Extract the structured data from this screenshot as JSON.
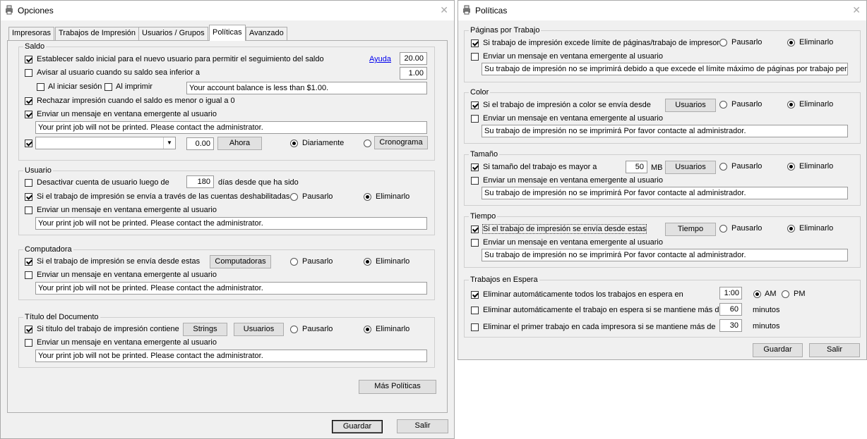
{
  "opciones": {
    "title": "Opciones",
    "close": "✕",
    "tabs": [
      "Impresoras",
      "Trabajos de Impresión",
      "Usuarios / Grupos",
      "Políticas",
      "Avanzado"
    ],
    "saldo": {
      "title": "Saldo",
      "initial_balance_label": "Establecer saldo inicial para el nuevo usuario para permitir el seguimiento del saldo",
      "help_link": "Ayuda",
      "initial_balance_value": "20.00",
      "notify_low_label": "Avisar al usuario cuando su saldo sea inferior a",
      "notify_low_value": "1.00",
      "on_login_label": "Al iniciar sesión",
      "on_print_label": "Al imprimir",
      "low_balance_message": "Your account balance is less than $1.00.",
      "reject_label": "Rechazar impresión cuando el saldo es menor o igual a 0",
      "popup_label": "Enviar un mensaje en ventana emergente al usuario",
      "popup_message": "Your print job will not be printed. Please contact the administrator.",
      "schedule_combo": "",
      "schedule_amount": "0.00",
      "now_button": "Ahora",
      "daily_label": "Diariamente",
      "schedule_button": "Cronograma"
    },
    "usuario": {
      "title": "Usuario",
      "deactivate_label": "Desactivar cuenta de usuario luego de",
      "deactivate_days": "180",
      "days_label": "días desde que ha sido",
      "disabled_accounts_label": "Si el trabajo de impresión se envía a través de las cuentas deshabilitadas",
      "pause_label": "Pausarlo",
      "delete_label": "Eliminarlo",
      "popup_label": "Enviar un mensaje en ventana emergente al usuario",
      "popup_message": "Your print job will not be printed. Please contact the administrator."
    },
    "computadora": {
      "title": "Computadora",
      "sent_from_label": "Si el trabajo de impresión se envía desde estas",
      "computers_button": "Computadoras",
      "pause_label": "Pausarlo",
      "delete_label": "Eliminarlo",
      "popup_label": "Enviar un mensaje en ventana emergente al usuario",
      "popup_message": "Your print job will not be printed. Please contact the administrator."
    },
    "titulo": {
      "title": "Título del Documento",
      "contains_label": "Si título del trabajo de impresión contiene",
      "strings_button": "Strings",
      "users_button": "Usuarios",
      "pause_label": "Pausarlo",
      "delete_label": "Eliminarlo",
      "popup_label": "Enviar un mensaje en ventana emergente al usuario",
      "popup_message": "Your print job will not be printed. Please contact the administrator."
    },
    "more_policies_button": "Más Políticas",
    "save_button": "Guardar",
    "exit_button": "Salir"
  },
  "politicas": {
    "title": "Políticas",
    "close": "✕",
    "paginas": {
      "title": "Páginas por Trabajo",
      "exceeds_label": "Si trabajo de impresión excede límite de páginas/trabajo de impresora",
      "pause_label": "Pausarlo",
      "delete_label": "Eliminarlo",
      "popup_label": "Enviar un mensaje en ventana emergente al usuario",
      "popup_message": "Su trabajo de impresión no se imprimirá debido a que excede el límite máximo de páginas por trabajo permitido"
    },
    "color": {
      "title": "Color",
      "color_label": "Si el trabajo de impresión a color se envía desde",
      "users_button": "Usuarios",
      "pause_label": "Pausarlo",
      "delete_label": "Eliminarlo",
      "popup_label": "Enviar un mensaje en ventana emergente al usuario",
      "popup_message": "Su trabajo de impresión no se imprimirá Por favor contacte al administrador."
    },
    "tamano": {
      "title": "Tamaño",
      "size_label": "Si tamaño del trabajo es mayor a",
      "size_value": "50",
      "size_unit": "MB",
      "users_button": "Usuarios",
      "pause_label": "Pausarlo",
      "delete_label": "Eliminarlo",
      "popup_label": "Enviar un mensaje en ventana emergente al usuario",
      "popup_message": "Su trabajo de impresión no se imprimirá Por favor contacte al administrador."
    },
    "tiempo": {
      "title": "Tiempo",
      "time_label": "Si el trabajo de impresión se envía desde estas",
      "time_button": "Tiempo",
      "pause_label": "Pausarlo",
      "delete_label": "Eliminarlo",
      "popup_label": "Enviar un mensaje en ventana emergente al usuario",
      "popup_message": "Su trabajo de impresión no se imprimirá Por favor contacte al administrador."
    },
    "espera": {
      "title": "Trabajos en Espera",
      "auto_all_label": "Eliminar automáticamente todos los trabajos en espera en",
      "auto_all_time": "1:00",
      "am_label": "AM",
      "pm_label": "PM",
      "auto_held_label": "Eliminar automáticamente el trabajo en espera si se mantiene más de",
      "auto_held_value": "60",
      "auto_held_unit": "minutos",
      "first_job_label": "Eliminar el primer trabajo en cada impresora si se mantiene más de",
      "first_job_value": "30",
      "first_job_unit": "minutos"
    },
    "save_button": "Guardar",
    "exit_button": "Salir"
  }
}
